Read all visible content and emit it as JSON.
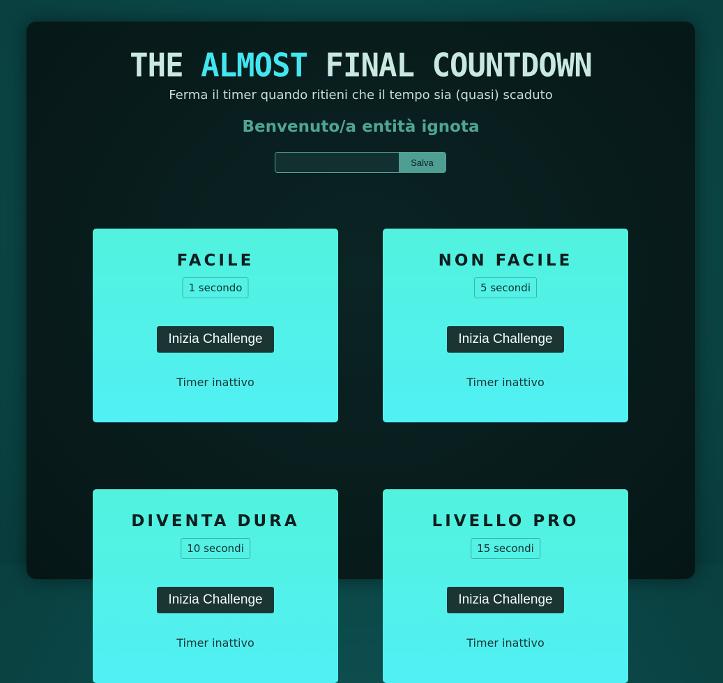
{
  "header": {
    "title_pre": "THE ",
    "title_accent": "ALMOST",
    "title_post": " FINAL COUNTDOWN",
    "subtitle": "Ferma il timer quando ritieni che il tempo sia (quasi) scaduto",
    "welcome": "Benvenuto/a entità ignota"
  },
  "name_form": {
    "value": "",
    "placeholder": "",
    "save_label": "Salva"
  },
  "cards": [
    {
      "title": "FACILE",
      "duration": "1 secondo",
      "button": "Inizia Challenge",
      "status": "Timer inattivo"
    },
    {
      "title": "NON FACILE",
      "duration": "5 secondi",
      "button": "Inizia Challenge",
      "status": "Timer inattivo"
    },
    {
      "title": "DIVENTA DURA",
      "duration": "10 secondi",
      "button": "Inizia Challenge",
      "status": "Timer inattivo"
    },
    {
      "title": "LIVELLO PRO",
      "duration": "15 secondi",
      "button": "Inizia Challenge",
      "status": "Timer inattivo"
    }
  ],
  "colors": {
    "accent": "#43e6f0",
    "card_gradient_top": "#52f2de",
    "card_gradient_bottom": "#51f0f4",
    "welcome_text": "#4fa594",
    "button_bg": "#1b3535"
  }
}
